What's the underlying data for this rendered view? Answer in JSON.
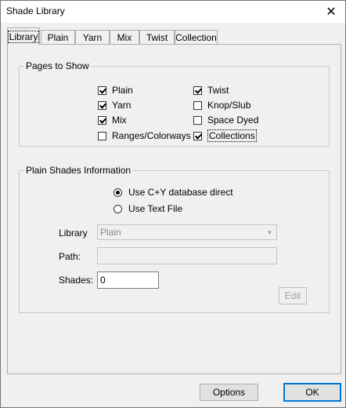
{
  "window": {
    "title": "Shade Library",
    "close_glyph": "✕"
  },
  "tabs": [
    {
      "label": "Library"
    },
    {
      "label": "Plain"
    },
    {
      "label": "Yarn"
    },
    {
      "label": "Mix"
    },
    {
      "label": "Twist"
    },
    {
      "label": "Collection"
    }
  ],
  "pages_group": {
    "title": "Pages to Show",
    "checkboxes": [
      {
        "label": "Plain",
        "checked": true
      },
      {
        "label": "Yarn",
        "checked": true
      },
      {
        "label": "Mix",
        "checked": true
      },
      {
        "label": "Ranges/Colorways",
        "checked": false
      },
      {
        "label": "Twist",
        "checked": true
      },
      {
        "label": "Knop/Slub",
        "checked": false
      },
      {
        "label": "Space Dyed",
        "checked": false
      },
      {
        "label": "Collections",
        "checked": true
      }
    ]
  },
  "plain_group": {
    "title": "Plain Shades Information",
    "radio_db": "Use C+Y database direct",
    "radio_text": "Use Text File",
    "library_label": "Library",
    "library_value": "Plain",
    "path_label": "Path:",
    "path_value": "",
    "shades_label": "Shades:",
    "shades_value": "0",
    "edit_label": "Edit"
  },
  "footer": {
    "options_label": "Options",
    "ok_label": "OK"
  }
}
